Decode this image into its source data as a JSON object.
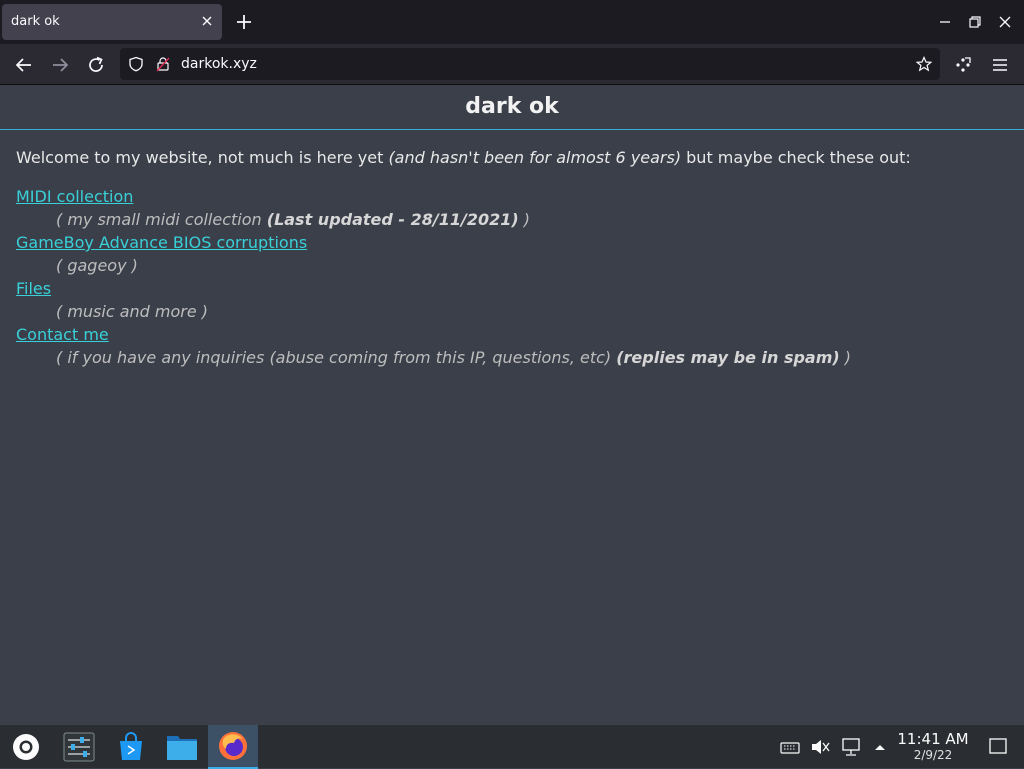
{
  "browser": {
    "tab_title": "dark ok",
    "url": "darkok.xyz"
  },
  "page": {
    "title": "dark ok",
    "intro_plain": "Welcome to my website, not much is here yet ",
    "intro_italic": "(and hasn't been for almost 6 years)",
    "intro_end": " but maybe check these out:",
    "links": [
      {
        "label": "MIDI collection",
        "desc_open": "( my small midi collection ",
        "desc_bold": "(Last updated - 28/11/2021)",
        "desc_close": " )"
      },
      {
        "label": "GameBoy Advance BIOS corruptions",
        "desc_open": "( gageoy )",
        "desc_bold": "",
        "desc_close": ""
      },
      {
        "label": "Files",
        "desc_open": "( music and more )",
        "desc_bold": "",
        "desc_close": ""
      },
      {
        "label": "Contact me",
        "desc_open": "( if you have any inquiries (abuse coming from this IP, questions, etc) ",
        "desc_bold": "(replies may be in spam)",
        "desc_close": " )"
      }
    ],
    "colors": {
      "link": "#39d0d8",
      "accent_line": "#38b0d8",
      "background": "#3b3f4a"
    }
  },
  "taskbar": {
    "apps": [
      "application-launcher-icon",
      "system-settings-icon",
      "discover-store-icon",
      "file-manager-icon",
      "firefox-icon"
    ],
    "clock_time": "11:41 AM",
    "clock_date": "2/9/22"
  }
}
